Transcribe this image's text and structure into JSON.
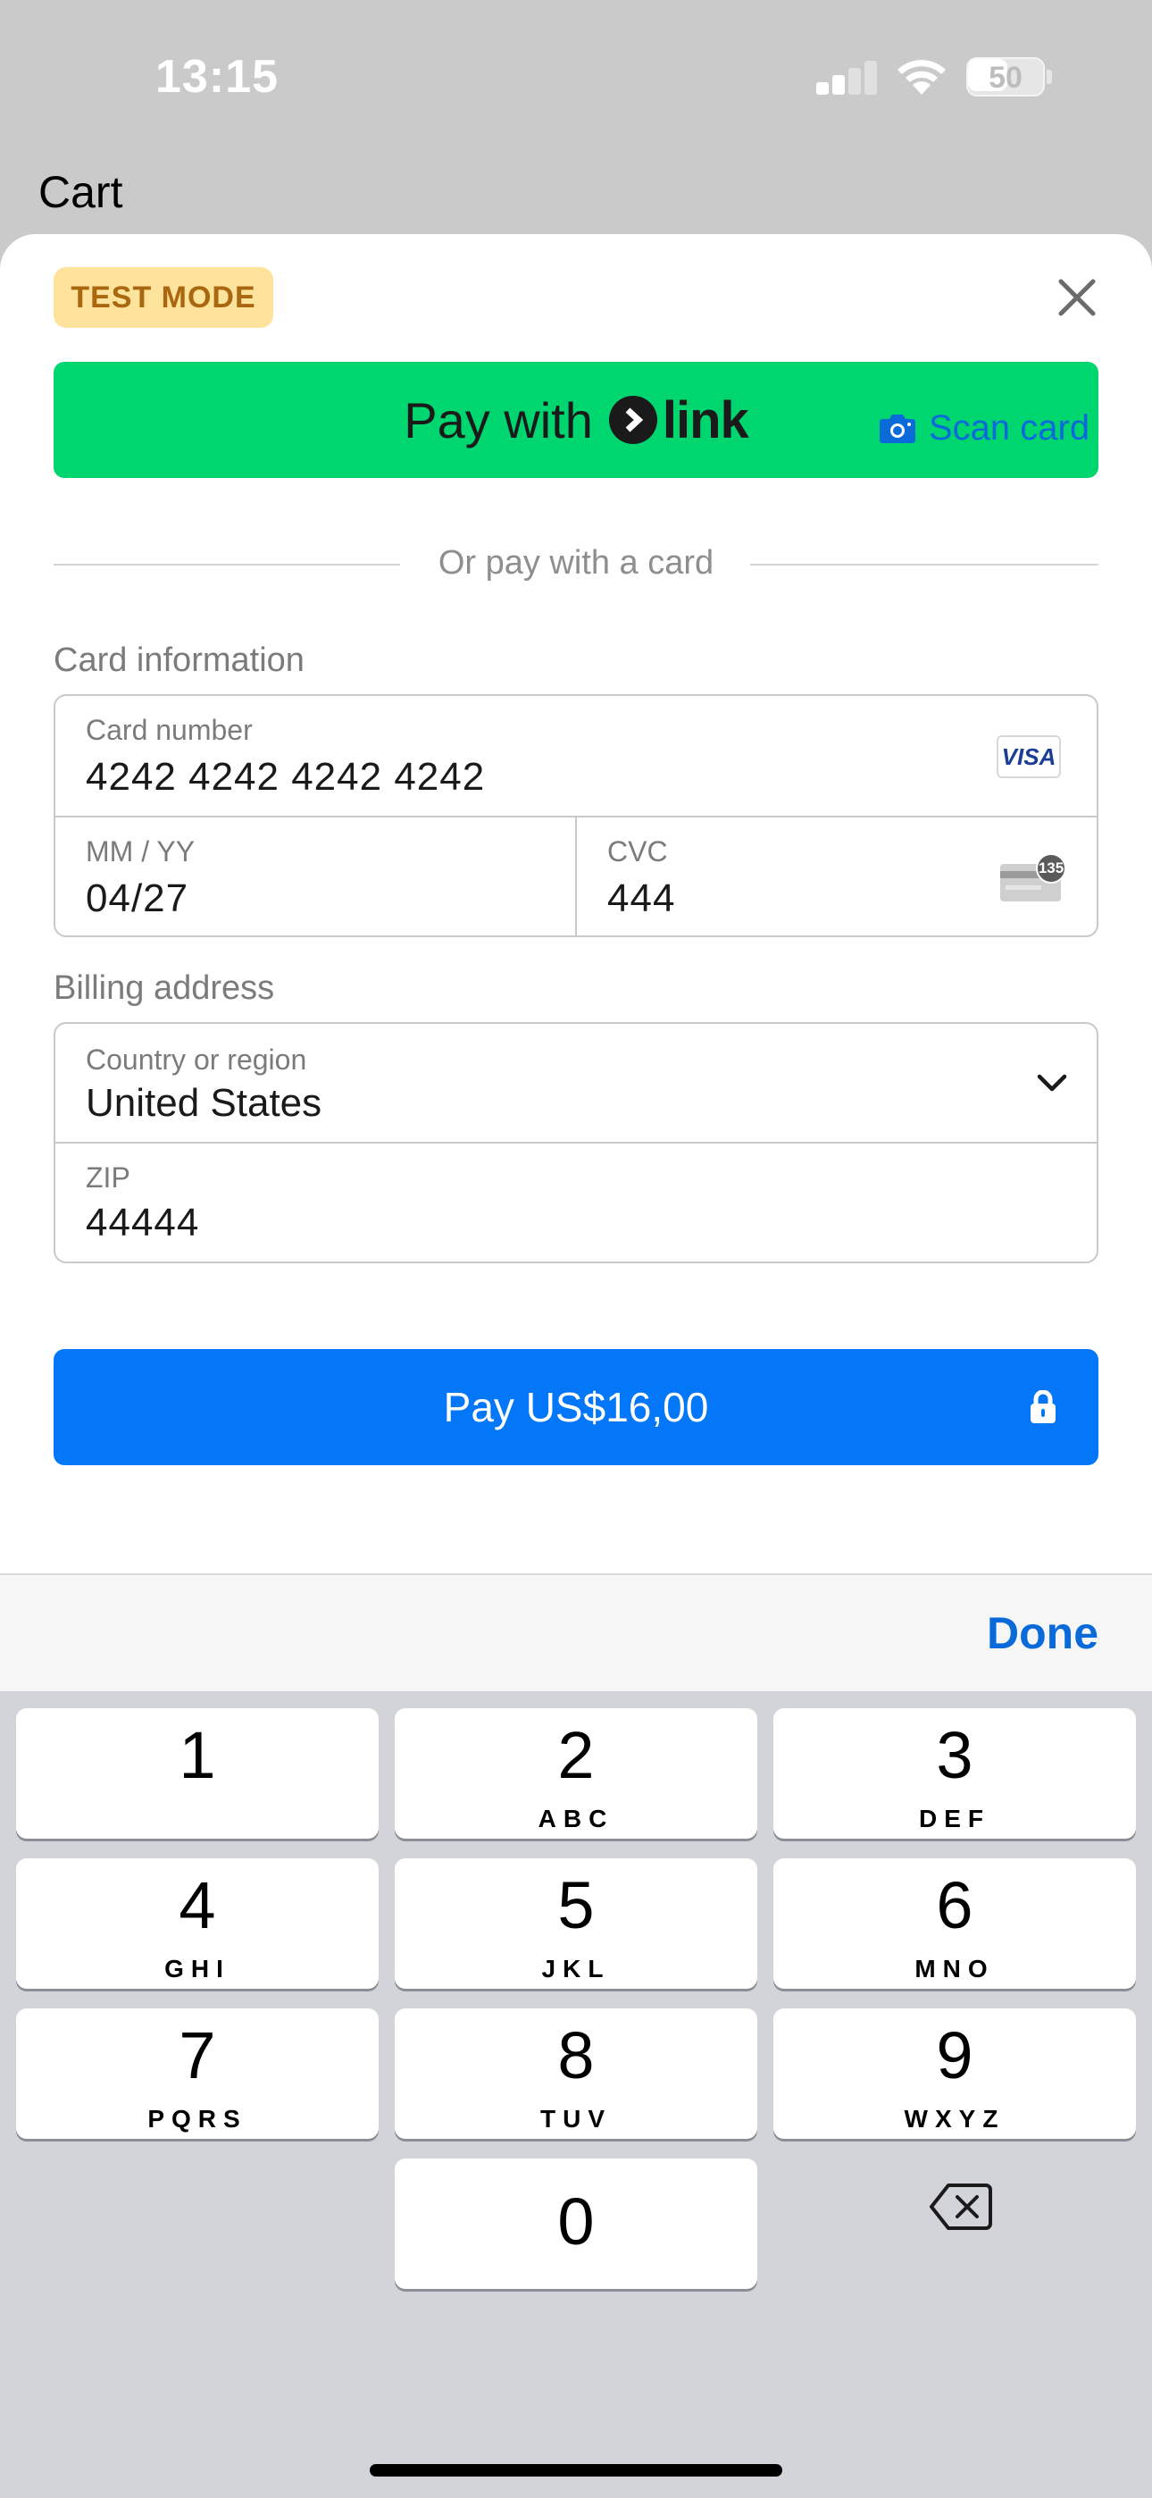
{
  "status_bar": {
    "time": "13:15",
    "battery_level": "50",
    "icons": [
      "cellular-signal-icon",
      "wifi-icon",
      "battery-icon"
    ]
  },
  "page": {
    "title": "Cart"
  },
  "sheet": {
    "test_mode_badge": "TEST MODE",
    "close_icon": "close-icon",
    "link_button": {
      "prefix": "Pay with",
      "brand": "link",
      "color": "#00d66f"
    },
    "divider_text": "Or pay with a card",
    "card_section": {
      "label": "Card information",
      "scan_card_label": "Scan card",
      "card_number": {
        "label": "Card number",
        "value": "4242 4242 4242 4242",
        "brand": "VISA"
      },
      "expiry": {
        "label": "MM / YY",
        "value": "04/27"
      },
      "cvc": {
        "label": "CVC",
        "value": "444",
        "hint_badge": "135"
      }
    },
    "billing_section": {
      "label": "Billing address",
      "country": {
        "label": "Country or region",
        "value": "United States"
      },
      "zip": {
        "label": "ZIP",
        "value": "44444"
      }
    },
    "pay_button": {
      "label": "Pay US$16,00",
      "color": "#0477f8"
    }
  },
  "keyboard": {
    "done_label": "Done",
    "keys": [
      {
        "digit": "1",
        "letters": ""
      },
      {
        "digit": "2",
        "letters": "ABC"
      },
      {
        "digit": "3",
        "letters": "DEF"
      },
      {
        "digit": "4",
        "letters": "GHI"
      },
      {
        "digit": "5",
        "letters": "JKL"
      },
      {
        "digit": "6",
        "letters": "MNO"
      },
      {
        "digit": "7",
        "letters": "PQRS"
      },
      {
        "digit": "8",
        "letters": "TUV"
      },
      {
        "digit": "9",
        "letters": "WXYZ"
      },
      {
        "digit": "0",
        "letters": ""
      }
    ]
  }
}
